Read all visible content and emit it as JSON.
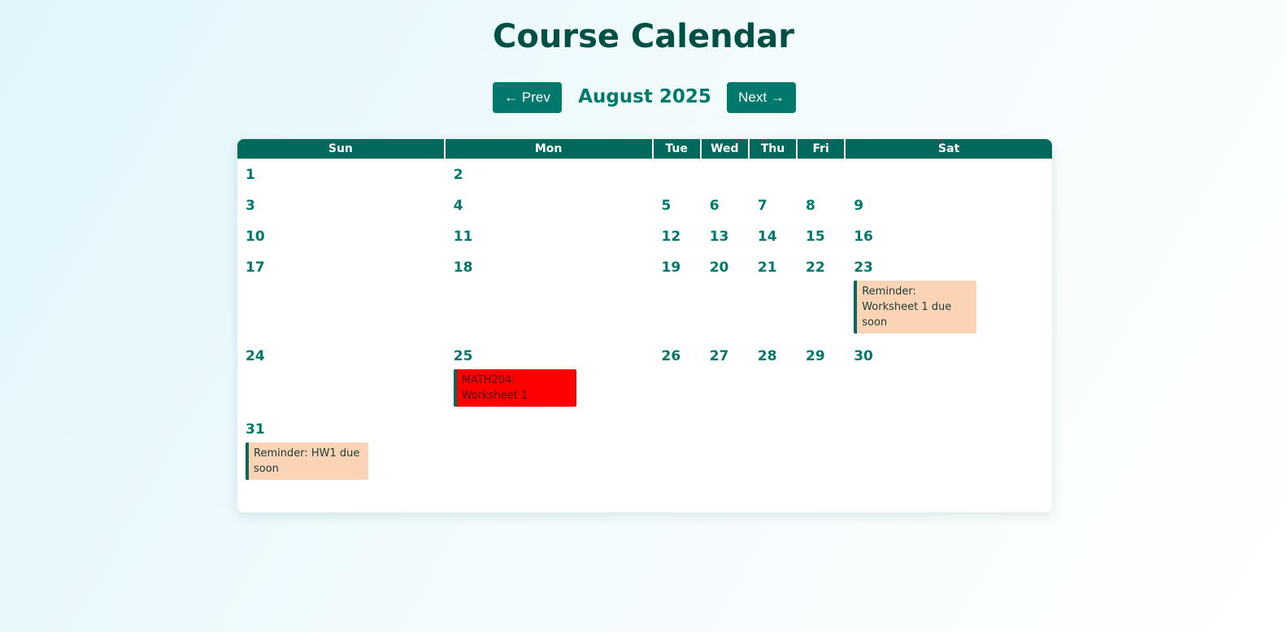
{
  "title": "Course Calendar",
  "nav": {
    "prev_label": "← Prev",
    "next_label": "Next →",
    "month_label": "August 2025"
  },
  "weekdays": [
    "Sun",
    "Mon",
    "Tue",
    "Wed",
    "Thu",
    "Fri",
    "Sat"
  ],
  "weeks": [
    [
      {
        "day": "1"
      },
      {
        "day": "2"
      },
      {
        "day": ""
      },
      {
        "day": ""
      },
      {
        "day": ""
      },
      {
        "day": ""
      },
      {
        "day": ""
      }
    ],
    [
      {
        "day": "3"
      },
      {
        "day": "4"
      },
      {
        "day": "5"
      },
      {
        "day": "6"
      },
      {
        "day": "7"
      },
      {
        "day": "8"
      },
      {
        "day": "9"
      }
    ],
    [
      {
        "day": "10"
      },
      {
        "day": "11"
      },
      {
        "day": "12"
      },
      {
        "day": "13"
      },
      {
        "day": "14"
      },
      {
        "day": "15"
      },
      {
        "day": "16"
      }
    ],
    [
      {
        "day": "17"
      },
      {
        "day": "18"
      },
      {
        "day": "19"
      },
      {
        "day": "20"
      },
      {
        "day": "21"
      },
      {
        "day": "22"
      },
      {
        "day": "23",
        "events": [
          {
            "text": "Reminder: Worksheet 1 due soon",
            "kind": "reminder"
          }
        ]
      }
    ],
    [
      {
        "day": "24"
      },
      {
        "day": "25",
        "events": [
          {
            "text": "MATH204: Worksheet 1",
            "kind": "due"
          }
        ]
      },
      {
        "day": "26"
      },
      {
        "day": "27"
      },
      {
        "day": "28"
      },
      {
        "day": "29"
      },
      {
        "day": "30"
      }
    ],
    [
      {
        "day": "31",
        "events": [
          {
            "text": "Reminder: HW1 due soon",
            "kind": "reminder"
          }
        ]
      }
    ]
  ],
  "colors": {
    "header": "#00695c",
    "accent": "#00796b",
    "title": "#005045",
    "reminder_bg": "#fbd3b5",
    "due_bg": "#ff0000"
  }
}
